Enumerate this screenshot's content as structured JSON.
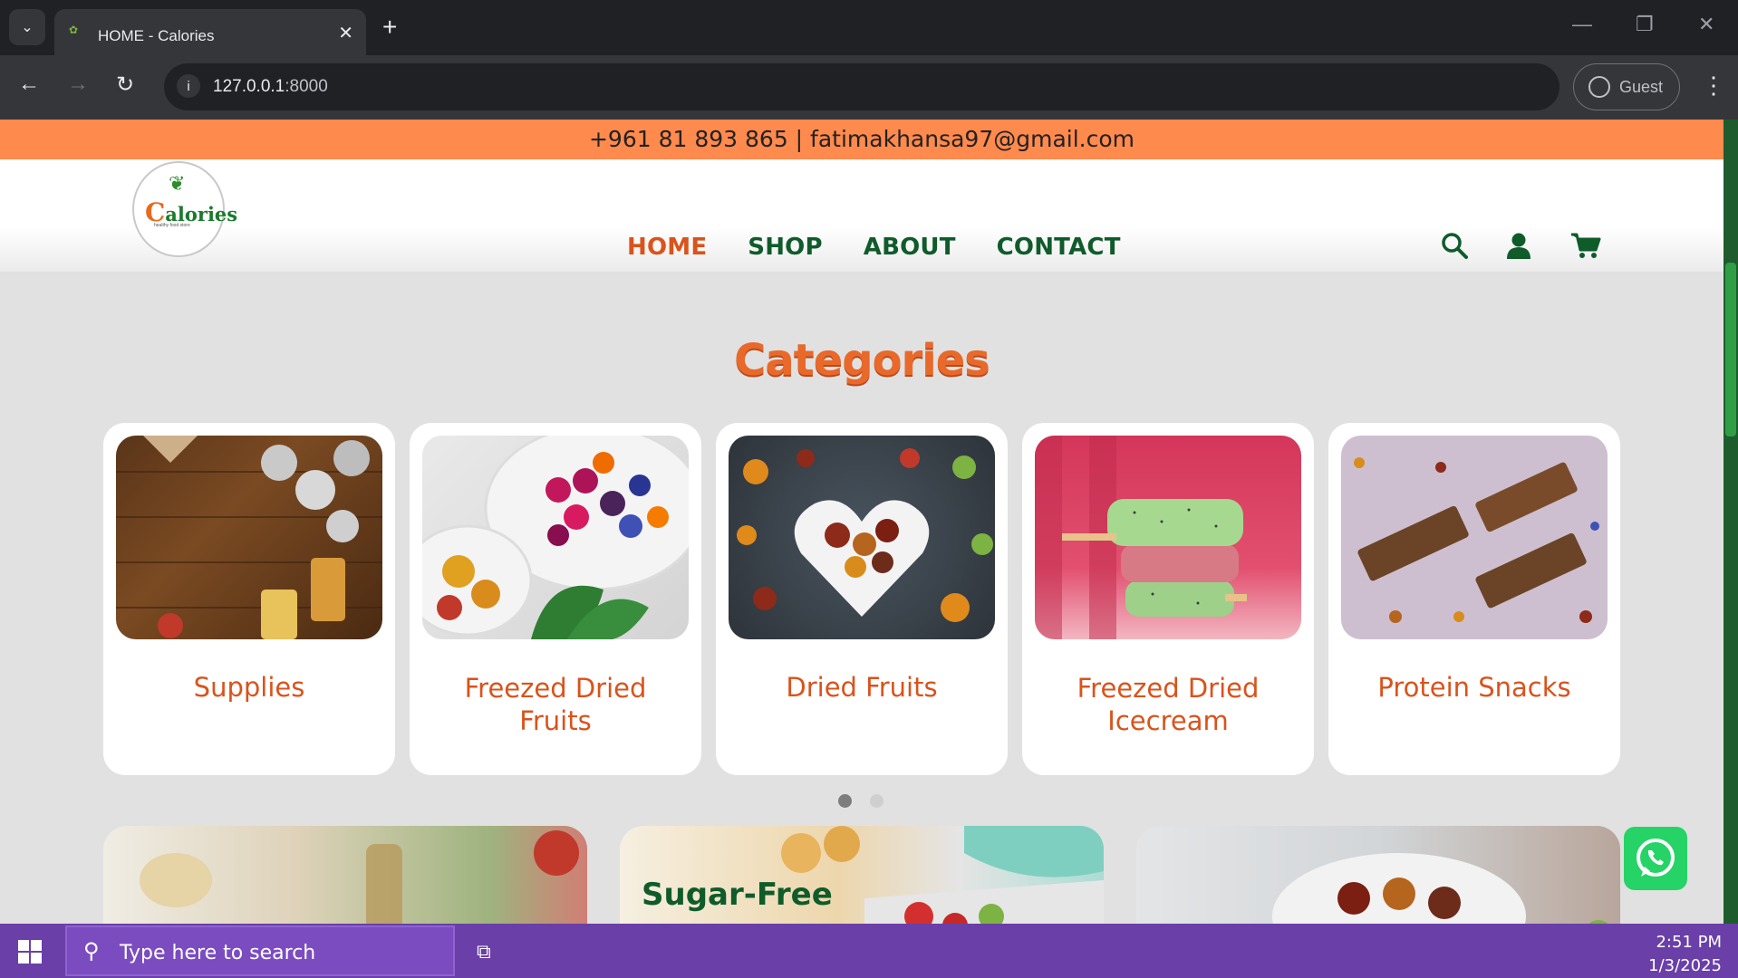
{
  "browser": {
    "tab_title": "HOME - Calories",
    "url_host": "127.0.0.1",
    "url_port": ":8000",
    "profile_label": "Guest"
  },
  "site": {
    "contact_line": "+961 81 893 865 | fatimakhansa97@gmail.com",
    "logo_text": "Calories",
    "logo_tagline": "healthy food store",
    "nav": [
      {
        "label": "HOME",
        "active": true
      },
      {
        "label": "SHOP",
        "active": false
      },
      {
        "label": "ABOUT",
        "active": false
      },
      {
        "label": "CONTACT",
        "active": false
      }
    ],
    "header_icons": [
      "search-icon",
      "user-icon",
      "cart-icon"
    ],
    "categories_title": "Categories",
    "categories": [
      {
        "label_line1": "Supplies",
        "label_line2": ""
      },
      {
        "label_line1": "Freezed Dried",
        "label_line2": "Fruits"
      },
      {
        "label_line1": "Dried Fruits",
        "label_line2": ""
      },
      {
        "label_line1": "Freezed Dried",
        "label_line2": "Icecream"
      },
      {
        "label_line1": "Protein Snacks",
        "label_line2": ""
      }
    ],
    "carousel_dots": 2,
    "carousel_active": 1,
    "promos": [
      {
        "title": ""
      },
      {
        "title": "Sugar-Free"
      },
      {
        "title": ""
      }
    ]
  },
  "taskbar": {
    "search_placeholder": "Type here to search",
    "time": "2:51 PM",
    "date": "1/3/2025"
  },
  "colors": {
    "brand_green": "#0f5b2a",
    "brand_orange": "#d9531c",
    "topbar_orange": "#ff8a4d",
    "taskbar_purple": "#6a3fa8"
  }
}
